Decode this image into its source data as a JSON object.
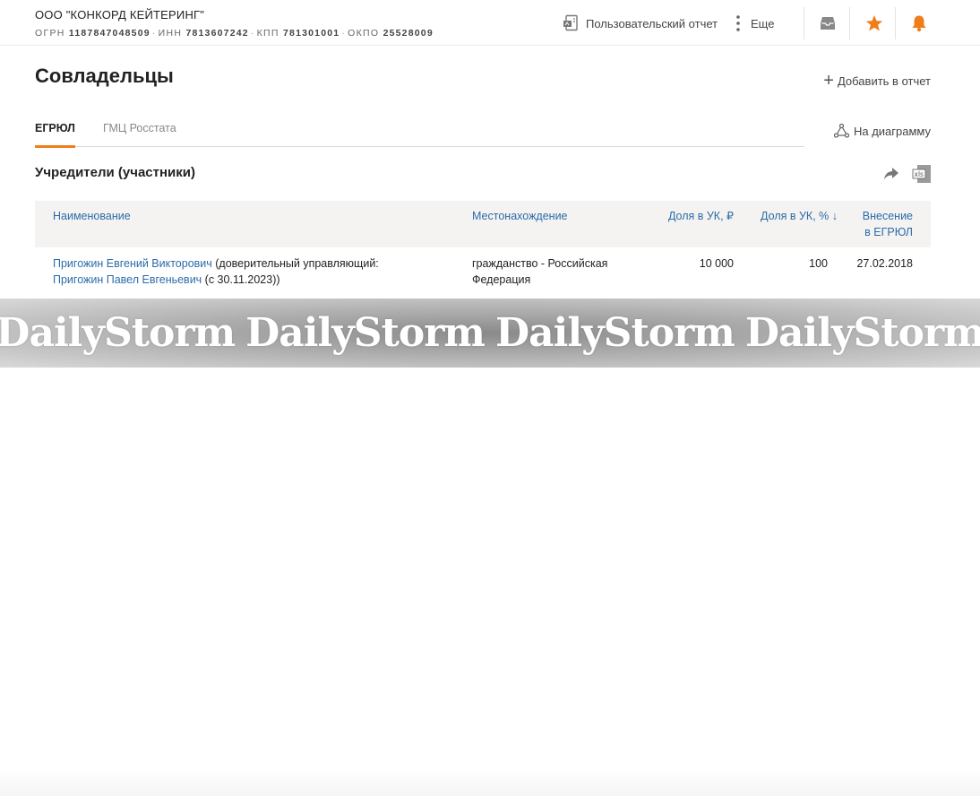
{
  "header": {
    "company_name": "ООО \"КОНКОРД КЕЙТЕРИНГ\"",
    "ogrn_label": "ОГРН",
    "ogrn": "1187847048509",
    "inn_label": "ИНН",
    "inn": "7813607242",
    "kpp_label": "КПП",
    "kpp": "781301001",
    "okpo_label": "ОКПО",
    "okpo": "25528009",
    "custom_report_label": "Пользовательский отчет",
    "more_label": "Еще",
    "accent_color": "#ef7e1a"
  },
  "page": {
    "title": "Совладельцы",
    "add_to_report_label": "Добавить в отчет",
    "to_diagram_label": "На диаграмму",
    "tabs": [
      {
        "label": "ЕГРЮЛ",
        "active": true
      },
      {
        "label": "ГМЦ Росстата",
        "active": false
      }
    ]
  },
  "section": {
    "title": "Учредители (участники)"
  },
  "table": {
    "columns": {
      "name": "Наименование",
      "location": "Местонахождение",
      "share_rub": "Доля в УК, ₽",
      "share_pct": "Доля в УК, %",
      "share_pct_sort": "↓",
      "date_line1": "Внесение",
      "date_line2": "в ЕГРЮЛ"
    },
    "rows": [
      {
        "name": "Пригожин Евгений Викторович",
        "trustee_prefix": " (доверительный управляющий:",
        "trustee_name": "Пригожин Павел Евгеньевич",
        "trustee_suffix": " (с 30.11.2023))",
        "location": "гражданство - Российская Федерация",
        "share_rub": "10 000",
        "share_pct": "100",
        "date": "27.02.2018"
      }
    ]
  },
  "watermark": {
    "text": "DailyStorm"
  }
}
